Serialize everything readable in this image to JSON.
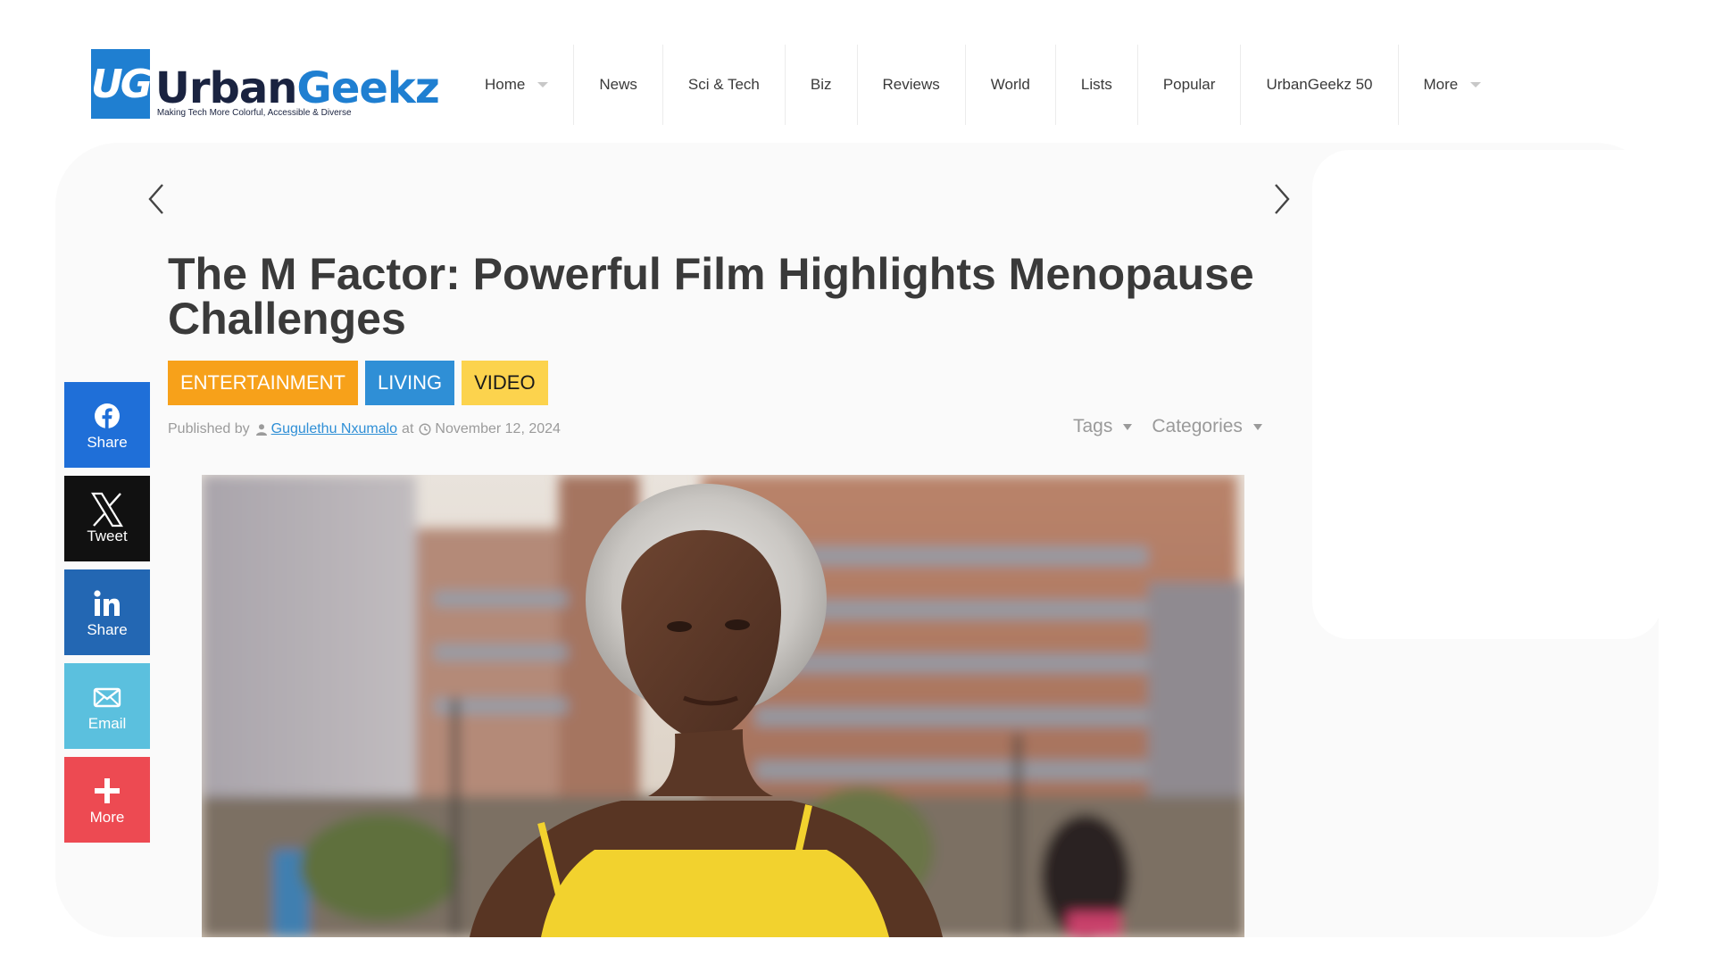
{
  "site": {
    "logo_badge": "UG",
    "logo_name_part1": "Urban",
    "logo_name_part2": "Geekz",
    "tagline": "Making Tech More Colorful, Accessible & Diverse",
    "brand_color": "#1f7fd1"
  },
  "nav": {
    "items": [
      {
        "label": "Home",
        "has_dropdown": true
      },
      {
        "label": "News",
        "has_dropdown": false
      },
      {
        "label": "Sci & Tech",
        "has_dropdown": false
      },
      {
        "label": "Biz",
        "has_dropdown": false
      },
      {
        "label": "Reviews",
        "has_dropdown": false
      },
      {
        "label": "World",
        "has_dropdown": false
      },
      {
        "label": "Lists",
        "has_dropdown": false
      },
      {
        "label": "Popular",
        "has_dropdown": false
      },
      {
        "label": "UrbanGeekz 50",
        "has_dropdown": false
      },
      {
        "label": "More",
        "has_dropdown": true
      }
    ]
  },
  "article": {
    "title": "The M Factor: Powerful Film Highlights Menopause Challenges",
    "categories": [
      {
        "label": "ENTERTAINMENT",
        "color": "#f7a11a"
      },
      {
        "label": "LIVING",
        "color": "#2f8fd6"
      },
      {
        "label": "VIDEO",
        "color": "#fcd34d"
      }
    ],
    "meta": {
      "published_by": "Published by",
      "author": "Gugulethu Nxumalo",
      "at": "at",
      "date": "November 12, 2024"
    },
    "dropdowns": {
      "tags": "Tags",
      "categories": "Categories"
    }
  },
  "share": {
    "buttons": [
      {
        "label": "Share",
        "icon": "facebook-icon",
        "color": "#1f6fd8"
      },
      {
        "label": "Tweet",
        "icon": "x-icon",
        "color": "#111111"
      },
      {
        "label": "Share",
        "icon": "linkedin-icon",
        "color": "#2367b3"
      },
      {
        "label": "Email",
        "icon": "email-icon",
        "color": "#5bc0de"
      },
      {
        "label": "More",
        "icon": "plus-icon",
        "color": "#ed4a52"
      }
    ]
  }
}
